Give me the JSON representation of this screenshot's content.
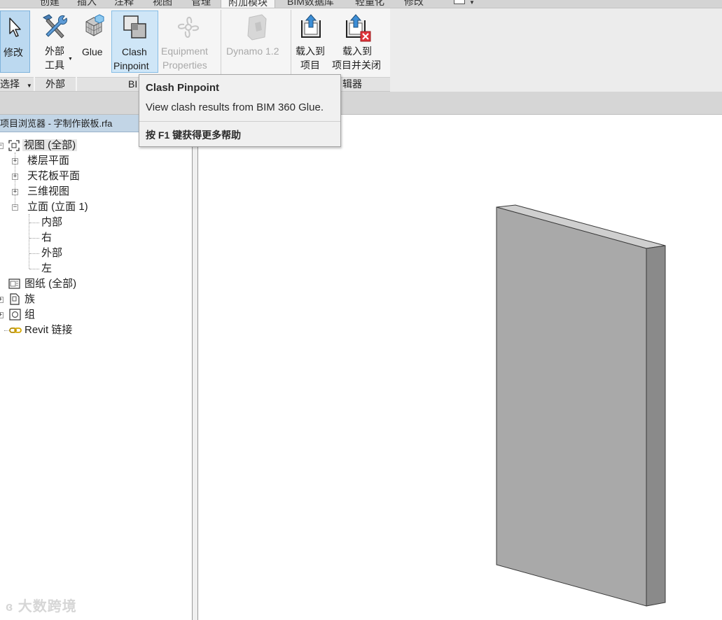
{
  "tabs": [
    "创建",
    "插入",
    "注释",
    "视图",
    "管理",
    "附加模块",
    "BIM数据库",
    "轻量化",
    "修改"
  ],
  "active_tab": "附加模块",
  "ribbon": {
    "modify": "修改",
    "external_tools_1": "外部",
    "external_tools_2": "工具",
    "glue": "Glue",
    "clash_1": "Clash",
    "clash_2": "Pinpoint",
    "equipment_1": "Equipment",
    "equipment_2": "Properties",
    "dynamo": "Dynamo 1.2",
    "load_1": "载入到",
    "load_2": "项目",
    "load_close_1": "载入到",
    "load_close_2": "项目并关闭",
    "panel_select": "选择",
    "panel_external": "外部",
    "panel_bim_partial": "BI",
    "panel_editor_partial": "辑器"
  },
  "tooltip": {
    "title": "Clash Pinpoint",
    "description": "View clash results from BIM 360 Glue.",
    "help": "按 F1 键获得更多帮助"
  },
  "browser": {
    "title": "项目浏览器 - 字制作嵌板.rfa",
    "views_all": "视图 (全部)",
    "floor_plans": "楼层平面",
    "ceiling_plans": "天花板平面",
    "3d_views": "三维视图",
    "elevations": "立面 (立面 1)",
    "interior": "内部",
    "right": "右",
    "exterior": "外部",
    "left": "左",
    "sheets": "图纸 (全部)",
    "families": "族",
    "groups": "组",
    "revit_links": "Revit 链接"
  },
  "watermark": "大数跨境",
  "colors": {
    "ribbon_bg": "#f5f5f5",
    "selected_button": "#cfe6f7",
    "browser_title_bg": "#c2d5e6",
    "panel_front": "#a9a9a9",
    "panel_side": "#8a8a8a",
    "panel_top": "#cfcfcf"
  }
}
